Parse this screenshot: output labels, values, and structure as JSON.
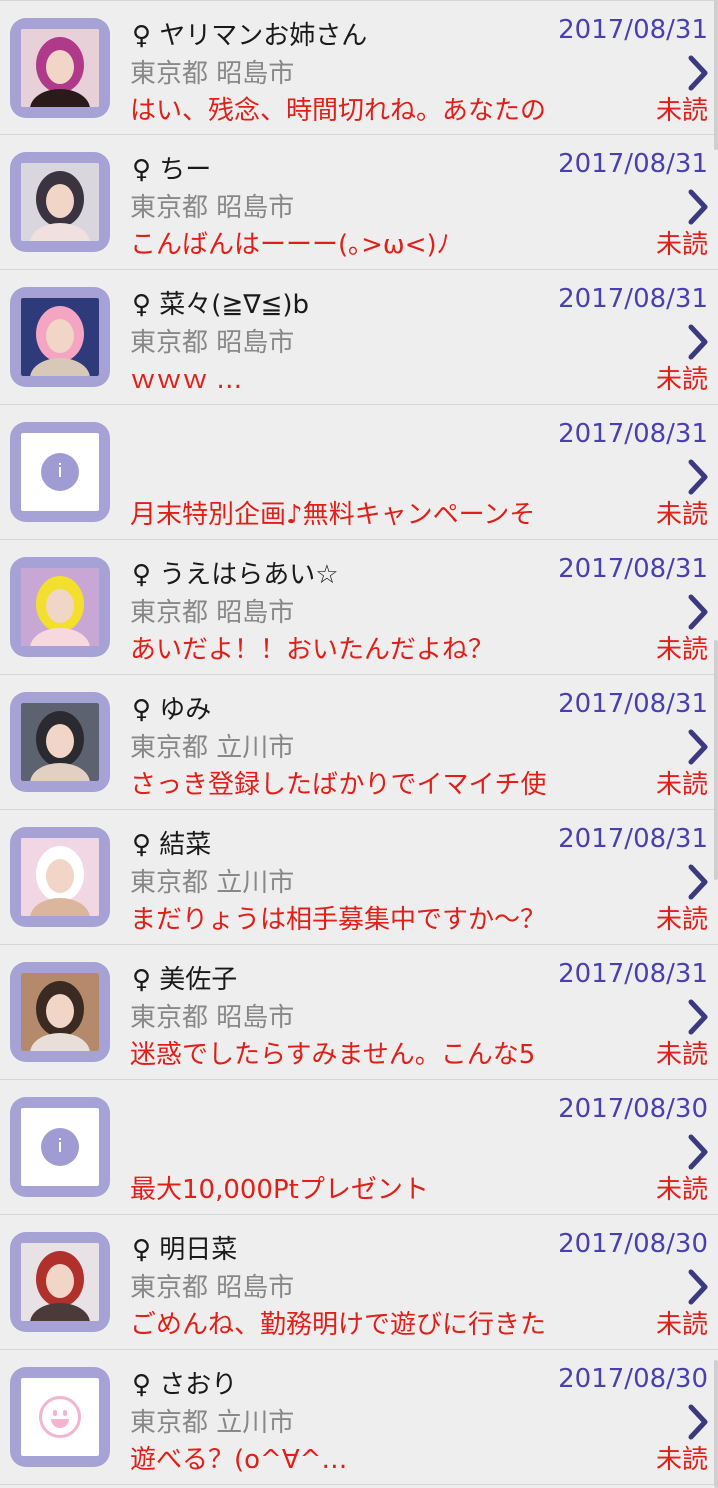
{
  "colors": {
    "background": "#efeeef",
    "avatar_frame": "#a7a2d6",
    "date": "#4a3fb1",
    "message": "#df1f18",
    "area": "#888888",
    "name": "#1a1a1a"
  },
  "messages": [
    {
      "name": "♀ ヤリマンお姉さん",
      "area": "東京都 昭島市",
      "preview": "はい、残念、時間切れね。あなたの",
      "date": "2017/08/31",
      "status": "未読",
      "avatar": "photo",
      "photo_colors": [
        "#e8d0d8",
        "#b03a8a",
        "#2a1a1a"
      ]
    },
    {
      "name": "♀ ちー",
      "area": "東京都 昭島市",
      "preview": "こんばんはーーー(｡>ω<)ﾉ",
      "date": "2017/08/31",
      "status": "未読",
      "avatar": "photo",
      "photo_colors": [
        "#d9d6de",
        "#3a3340",
        "#f0e0e0"
      ]
    },
    {
      "name": "♀ 菜々(≧∇≦)b",
      "area": "東京都 昭島市",
      "preview": "ｗｗｗ …",
      "date": "2017/08/31",
      "status": "未読",
      "avatar": "photo",
      "photo_colors": [
        "#2f3a7a",
        "#f3a5c2",
        "#d8c8b8"
      ]
    },
    {
      "name": "",
      "area": "",
      "preview": "月末特別企画♪無料キャンペーンそ",
      "date": "2017/08/31",
      "status": "未読",
      "avatar": "info-icon"
    },
    {
      "name": "♀ うえはらあい☆",
      "area": "東京都 昭島市",
      "preview": "あいだよ！！おいたんだよね？",
      "date": "2017/08/31",
      "status": "未読",
      "avatar": "photo",
      "photo_colors": [
        "#c9a7d4",
        "#f2df2e",
        "#f7d8df"
      ]
    },
    {
      "name": "♀ ゆみ",
      "area": "東京都 立川市",
      "preview": "さっき登録したばかりでイマイチ使",
      "date": "2017/08/31",
      "status": "未読",
      "avatar": "photo",
      "photo_colors": [
        "#5c6270",
        "#2a2a30",
        "#e3cfc3"
      ]
    },
    {
      "name": "♀ 結菜",
      "area": "東京都 立川市",
      "preview": "まだりょうは相手募集中ですか～？",
      "date": "2017/08/31",
      "status": "未読",
      "avatar": "photo",
      "photo_colors": [
        "#f1d6e3",
        "#ffffff",
        "#d9b69c"
      ]
    },
    {
      "name": "♀ 美佐子",
      "area": "東京都 昭島市",
      "preview": "迷惑でしたらすみません。こんな5",
      "date": "2017/08/31",
      "status": "未読",
      "avatar": "photo",
      "photo_colors": [
        "#b58a6c",
        "#3a2a22",
        "#e8e0d8"
      ]
    },
    {
      "name": "",
      "area": "",
      "preview": "最大10,000Ptプレゼント",
      "date": "2017/08/30",
      "status": "未読",
      "avatar": "info-icon"
    },
    {
      "name": "♀ 明日菜",
      "area": "東京都 昭島市",
      "preview": "ごめんね、勤務明けで遊びに行きた",
      "date": "2017/08/30",
      "status": "未読",
      "avatar": "photo",
      "photo_colors": [
        "#e8e2e6",
        "#b0312b",
        "#4a3a3a"
      ]
    },
    {
      "name": "♀ さおり",
      "area": "東京都 立川市",
      "preview": "遊べる？(o^∀^…",
      "date": "2017/08/30",
      "status": "未読",
      "avatar": "smiley-icon"
    }
  ]
}
